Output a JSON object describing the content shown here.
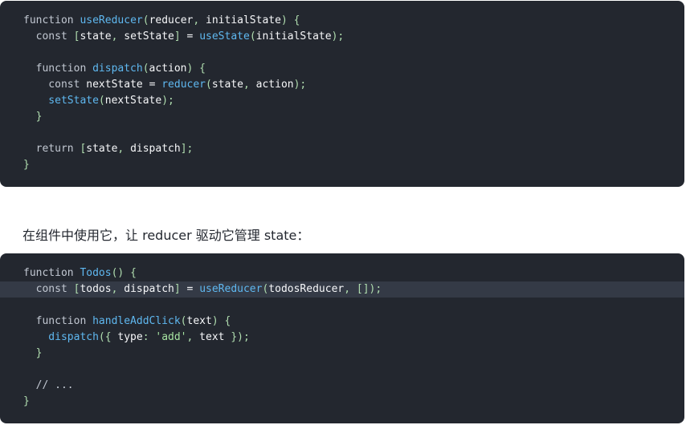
{
  "code_blocks": [
    {
      "name": "code-block-usereducer",
      "highlight_line": -1,
      "lines": [
        [
          [
            "kw",
            "function "
          ],
          [
            "fn",
            "useReducer"
          ],
          [
            "pu",
            "("
          ],
          [
            "id",
            "reducer"
          ],
          [
            "pu",
            ", "
          ],
          [
            "id",
            "initialState"
          ],
          [
            "pu",
            ") {"
          ]
        ],
        [
          [
            "kw",
            "  const "
          ],
          [
            "pu",
            "["
          ],
          [
            "id",
            "state"
          ],
          [
            "pu",
            ", "
          ],
          [
            "id",
            "setState"
          ],
          [
            "pu",
            "] "
          ],
          [
            "op",
            "= "
          ],
          [
            "fn",
            "useState"
          ],
          [
            "pu",
            "("
          ],
          [
            "id",
            "initialState"
          ],
          [
            "pu",
            ");"
          ]
        ],
        [],
        [
          [
            "kw",
            "  function "
          ],
          [
            "fn",
            "dispatch"
          ],
          [
            "pu",
            "("
          ],
          [
            "id",
            "action"
          ],
          [
            "pu",
            ") {"
          ]
        ],
        [
          [
            "kw",
            "    const "
          ],
          [
            "id",
            "nextState "
          ],
          [
            "op",
            "= "
          ],
          [
            "fn",
            "reducer"
          ],
          [
            "pu",
            "("
          ],
          [
            "id",
            "state"
          ],
          [
            "pu",
            ", "
          ],
          [
            "id",
            "action"
          ],
          [
            "pu",
            ");"
          ]
        ],
        [
          [
            "fn",
            "    setState"
          ],
          [
            "pu",
            "("
          ],
          [
            "id",
            "nextState"
          ],
          [
            "pu",
            ");"
          ]
        ],
        [
          [
            "pu",
            "  }"
          ]
        ],
        [],
        [
          [
            "kw",
            "  return "
          ],
          [
            "pu",
            "["
          ],
          [
            "id",
            "state"
          ],
          [
            "pu",
            ", "
          ],
          [
            "id",
            "dispatch"
          ],
          [
            "pu",
            "];"
          ]
        ],
        [
          [
            "pu",
            "}"
          ]
        ]
      ]
    },
    {
      "name": "code-block-todos",
      "highlight_line": 1,
      "lines": [
        [
          [
            "kw",
            "function "
          ],
          [
            "fn",
            "Todos"
          ],
          [
            "pu",
            "() {"
          ]
        ],
        [
          [
            "kw",
            "  const "
          ],
          [
            "pu",
            "["
          ],
          [
            "id",
            "todos"
          ],
          [
            "pu",
            ", "
          ],
          [
            "id",
            "dispatch"
          ],
          [
            "pu",
            "] "
          ],
          [
            "op",
            "= "
          ],
          [
            "fn",
            "useReducer"
          ],
          [
            "pu",
            "("
          ],
          [
            "id",
            "todosReducer"
          ],
          [
            "pu",
            ", [])"
          ],
          [
            "pu",
            ";"
          ]
        ],
        [],
        [
          [
            "kw",
            "  function "
          ],
          [
            "fn",
            "handleAddClick"
          ],
          [
            "pu",
            "("
          ],
          [
            "id",
            "text"
          ],
          [
            "pu",
            ") {"
          ]
        ],
        [
          [
            "fn",
            "    dispatch"
          ],
          [
            "pu",
            "({ "
          ],
          [
            "id",
            "type"
          ],
          [
            "pu",
            ": "
          ],
          [
            "str",
            "'add'"
          ],
          [
            "pu",
            ", "
          ],
          [
            "id",
            "text "
          ],
          [
            "pu",
            "});"
          ]
        ],
        [
          [
            "pu",
            "  }"
          ]
        ],
        [],
        [
          [
            "cm",
            "  // ..."
          ]
        ],
        [
          [
            "pu",
            "}"
          ]
        ]
      ]
    }
  ],
  "prose": {
    "text": "在组件中使用它，让 reducer 驱动它管理 state："
  },
  "colors": {
    "code_background": "#23272f",
    "highlight_background": "#343a46",
    "function_name": "#5fb8f0",
    "string": "#a6e3a1",
    "punctuation": "#b0ddaf"
  }
}
